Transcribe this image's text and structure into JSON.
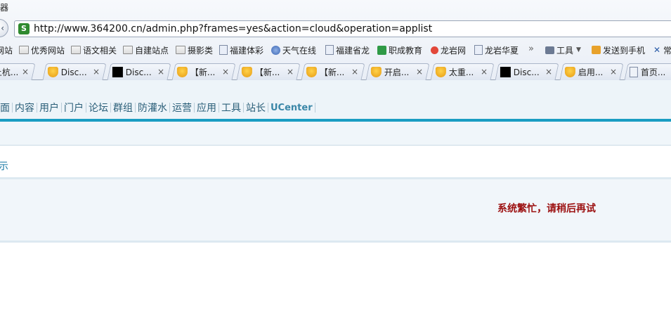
{
  "browser": {
    "title_fragment": "器",
    "url": "http://www.364200.cn/admin.php?frames=yes&action=cloud&operation=applist",
    "bookmarks": [
      {
        "label": "网站",
        "icon": "none"
      },
      {
        "label": "优秀网站",
        "icon": "folder-icon"
      },
      {
        "label": "语文相关",
        "icon": "folder-icon"
      },
      {
        "label": "自建站点",
        "icon": "folder-icon"
      },
      {
        "label": "摄影类",
        "icon": "folder-icon"
      },
      {
        "label": "福建体彩",
        "icon": "page-icon"
      },
      {
        "label": "天气在线",
        "icon": "globe-icon"
      },
      {
        "label": "福建省龙",
        "icon": "page-icon"
      },
      {
        "label": "职成教育",
        "icon": "green-icon"
      },
      {
        "label": "龙岩网",
        "icon": "red-icon"
      },
      {
        "label": "龙岩华夏",
        "icon": "page-icon"
      },
      {
        "label": "工具",
        "icon": "tools-icon"
      },
      {
        "label": "发送到手机",
        "icon": "phone-icon"
      },
      {
        "label": "常",
        "icon": "x-icon"
      }
    ],
    "bookmarks_overflow": "»",
    "tabs": [
      {
        "label": "上杭...",
        "icon": "none"
      },
      {
        "label": "Disc...",
        "icon": "cup-icon"
      },
      {
        "label": "Disc...",
        "icon": "black-icon"
      },
      {
        "label": "【新...",
        "icon": "cup-icon"
      },
      {
        "label": "【新...",
        "icon": "cup-icon"
      },
      {
        "label": "【新...",
        "icon": "cup-icon"
      },
      {
        "label": "开启...",
        "icon": "cup-icon"
      },
      {
        "label": "太重...",
        "icon": "cup-icon"
      },
      {
        "label": "Disc...",
        "icon": "black-icon"
      },
      {
        "label": "启用...",
        "icon": "cup-icon"
      },
      {
        "label": "首页...",
        "icon": "doc-icon"
      }
    ],
    "tab_close_glyph": "×"
  },
  "admin": {
    "nav": [
      "面",
      "内容",
      "用户",
      "门户",
      "论坛",
      "群组",
      "防灌水",
      "运营",
      "应用",
      "工具",
      "站长",
      "UCenter"
    ],
    "tip_label": "示",
    "message": "系统繁忙，请稍后再试"
  },
  "colors": {
    "accent_teal": "#1a9dc2",
    "message_red": "#9b0f0f",
    "nav_text": "#2b5f79"
  }
}
